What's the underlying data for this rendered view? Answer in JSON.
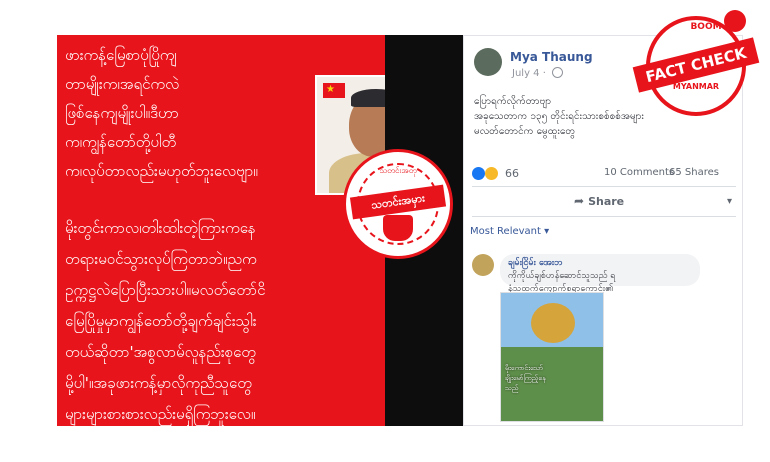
{
  "quote_card": {
    "lines_top": "ဖားကန့်မြေစာပုံပြိုကျ\nတာမျိုးက၊အရင်ကလဲ\nဖြစ်နေကျမျိုးပါ။ဒီဟာ\nက၊ကျွန်တော်တို့ပါတီ\nက၊လုပ်တာလည်းမဟုတ်ဘူးလေဗျာ။",
    "lines_bottom": "မိုးတွင်းကာလ၊တါးထါးတဲ့ကြားကနေ\nတရားမဝင်သွားလုပ်ကြတာဘဲ။ညက\nဥက္ကဋ္ဌလဲပြောပြီးသားပါ။မလတ်တော်ငိ\nမြေပြိုမှုမှာကျွန်တော်တို့ချက်ချင်းသွါး\nတယ်ဆိုတာ'အစွလာမ်လူနည်းစုတွေ\nမို့ပါ'။အခုဖားကန့်မှာလိုကုညီသူတွေ\nများများစားစားလည်းမရှိကြဘူးလေ။"
  },
  "stamp": {
    "top_text": "သတင်းအတု",
    "band_text": "သတင်းအမှား"
  },
  "boom": {
    "top": "BOOM",
    "band": "FACT CHECK",
    "bottom": "MYANMAR"
  },
  "fb_post": {
    "poster_name": "Mya Thaung",
    "date": "July 4 ·",
    "text": "ပြောရက်လိုက်တာဗျာ\nအခုသေတာက ၁၃၅ တိုင်းရင်းသားစစ်စစ်အများ\nမလတ်တောင်က မွေထူးတွေ",
    "reaction_count": "66",
    "comments": "10 Comments",
    "shares": "65 Shares",
    "share_label": "Share",
    "most_relevant": "Most Relevant ▾",
    "comment": {
      "name": "ချမ်းငြိမ်း အေးဘ",
      "text": "ကိုကိုယ်ချစ်ဟန်ဆောင်သူသည် ရ\nနံသူထက်ကျောက်စရာကောင်း၏"
    },
    "comment_image_text": "မိုးကောင်းသော်\nချိုးမော်ကြည့်နေ\nသည်"
  },
  "colors": {
    "card_red": "#e8141b",
    "fb_link": "#385898"
  }
}
